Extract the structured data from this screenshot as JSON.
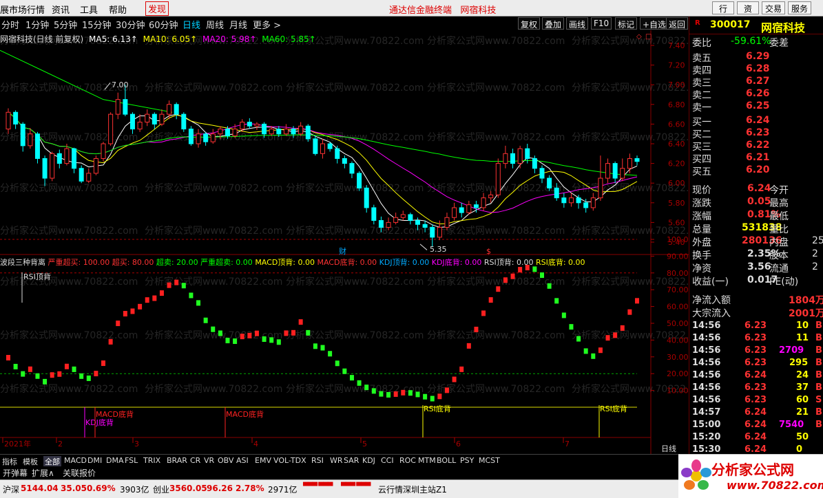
{
  "menu": {
    "left": [
      "展市场行情",
      "资讯",
      "工具",
      "帮助"
    ],
    "discover": "发现",
    "center": "通达信金融终端   网宿科技",
    "right": [
      "行情",
      "资讯",
      "交易",
      "服务"
    ]
  },
  "periods": [
    "分时",
    "1分钟",
    "5分钟",
    "15分钟",
    "30分钟",
    "60分钟",
    "日线",
    "周线",
    "月线",
    "更多 >"
  ],
  "selected_period": "日线",
  "toolbar_right": [
    "复权",
    "叠加",
    "画线",
    "F10",
    "标记",
    "+自选",
    "返回"
  ],
  "main_legend": {
    "name": "网宿科技(日线 前复权)",
    "ma5": "MA5: 6.13↑",
    "ma10": "MA10: 6.05↑",
    "ma20": "MA20: 5.98↑",
    "ma60": "MA60: 5.85↑",
    "colors": {
      "ma5": "#ffffff",
      "ma10": "#ffff00",
      "ma20": "#ff00ff",
      "ma60": "#00ff00",
      "up": "#ff3232",
      "down": "#00ffff"
    }
  },
  "indicator_legend": [
    {
      "text": "波段三种背离",
      "color": "#dddddd"
    },
    {
      "text": "严重超买: 100.00",
      "color": "#ff3232"
    },
    {
      "text": "超买: 80.00",
      "color": "#ff3232"
    },
    {
      "text": "超卖: 20.00",
      "color": "#00ff00"
    },
    {
      "text": "严重超卖: 0.00",
      "color": "#00ff00"
    },
    {
      "text": "MACD顶背: 0.00",
      "color": "#ffff00"
    },
    {
      "text": "MACD底背: 0.00",
      "color": "#ff3232"
    },
    {
      "text": "KDJ顶背: 0.00",
      "color": "#00aaff"
    },
    {
      "text": "KDJ底背: 0.00",
      "color": "#ff00ff"
    },
    {
      "text": "RSI顶背: 0.00",
      "color": "#dddddd"
    },
    {
      "text": "RSI底背: 0.00",
      "color": "#ffff00"
    }
  ],
  "price_axis": [
    "7.40",
    "7.20",
    "7.00",
    "6.80",
    "6.60",
    "6.40",
    "6.20",
    "6.00",
    "5.80",
    "5.60",
    "5.40"
  ],
  "ind_axis": [
    "100.00",
    "90.00",
    "80.00",
    "70.00",
    "60.00",
    "50.00",
    "40.00",
    "30.00",
    "20.00",
    "10.00"
  ],
  "annotations": {
    "high": "7.00",
    "low": "5.35",
    "cai": "财",
    "dollar": "$",
    "rsi_top": "RSI顶背",
    "macd_bottom1": "MACD底背",
    "kdj_bottom": "KDJ底背",
    "macd_bottom2": "MACD底背",
    "rsi_bottom1": "RSI底背",
    "rsi_bottom2": "RSI底背",
    "watermark": "分析家公式网www.70822.com"
  },
  "date_axis": [
    "2021年",
    "2",
    "3",
    "4",
    "5",
    "6",
    "7"
  ],
  "date_axis_right": "日线",
  "stock": {
    "code": "300017",
    "name": "网宿科技"
  },
  "order_book": {
    "weibi": {
      "label": "委比",
      "value": "-59.61%",
      "label2": "委差"
    },
    "sells": [
      {
        "label": "卖五",
        "price": "6.29"
      },
      {
        "label": "卖四",
        "price": "6.28"
      },
      {
        "label": "卖三",
        "price": "6.27"
      },
      {
        "label": "卖二",
        "price": "6.26"
      },
      {
        "label": "卖一",
        "price": "6.25"
      }
    ],
    "buys": [
      {
        "label": "买一",
        "price": "6.24"
      },
      {
        "label": "买二",
        "price": "6.23"
      },
      {
        "label": "买三",
        "price": "6.22"
      },
      {
        "label": "买四",
        "price": "6.21"
      },
      {
        "label": "买五",
        "price": "6.20"
      }
    ]
  },
  "quote": [
    {
      "l": "现价",
      "v": "6.24",
      "r": "今开",
      "vc": "#ff3232"
    },
    {
      "l": "涨跌",
      "v": "0.05",
      "r": "最高",
      "vc": "#ff3232"
    },
    {
      "l": "涨幅",
      "v": "0.81%",
      "r": "最低",
      "vc": "#ff3232"
    },
    {
      "l": "总量",
      "v": "531838",
      "r": "量比",
      "vc": "#ffff00"
    },
    {
      "l": "外盘",
      "v": "280136",
      "r": "内盘",
      "vc": "#ff3232",
      "r2": "25"
    },
    {
      "l": "换手",
      "v": "2.35%",
      "r": "股本",
      "vc": "#dddddd",
      "r2": "2"
    },
    {
      "l": "净资",
      "v": "3.56",
      "r": "流通",
      "vc": "#dddddd",
      "r2": "2"
    },
    {
      "l": "收益(一)",
      "v": "0.017",
      "r": "PE(动)",
      "vc": "#dddddd"
    }
  ],
  "flows": [
    {
      "l": "净流入额",
      "v": "1804万"
    },
    {
      "l": "大宗流入",
      "v": "2001万"
    }
  ],
  "ticks": [
    {
      "t": "14:56",
      "p": "6.23",
      "v": "10",
      "s": "B",
      "vc": "#ffff00"
    },
    {
      "t": "14:56",
      "p": "6.23",
      "v": "11",
      "s": "B",
      "vc": "#ffff00"
    },
    {
      "t": "14:56",
      "p": "6.23",
      "v": "2709",
      "s": "B",
      "vc": "#ff00ff"
    },
    {
      "t": "14:56",
      "p": "6.23",
      "v": "295",
      "s": "B",
      "vc": "#ffff00"
    },
    {
      "t": "14:56",
      "p": "6.24",
      "v": "24",
      "s": "B",
      "vc": "#ffff00"
    },
    {
      "t": "14:56",
      "p": "6.23",
      "v": "37",
      "s": "B",
      "vc": "#ffff00"
    },
    {
      "t": "14:56",
      "p": "6.23",
      "v": "60",
      "s": "S",
      "vc": "#ffff00"
    },
    {
      "t": "14:57",
      "p": "6.24",
      "v": "21",
      "s": "B",
      "vc": "#ffff00"
    },
    {
      "t": "15:00",
      "p": "6.24",
      "v": "7540",
      "s": "B",
      "vc": "#ff00ff"
    },
    {
      "t": "15:20",
      "p": "6.24",
      "v": "50",
      "s": "",
      "vc": "#ffff00"
    },
    {
      "t": "15:30",
      "p": "6.24",
      "v": "0",
      "s": "",
      "vc": "#ffff00"
    }
  ],
  "bottom_tabs": [
    "指标",
    "模板",
    "全部",
    "MACD",
    "DMI",
    "DMA",
    "FSL",
    "TRIX",
    "BRAR",
    "CR",
    "VR",
    "OBV",
    "ASI",
    "EMV",
    "VOL-TDX",
    "RSI",
    "WR",
    "SAR",
    "KDJ",
    "CCI",
    "ROC",
    "MTM",
    "BOLL",
    "PSY",
    "MCST"
  ],
  "active_tab": "全部",
  "bar2": [
    "开弹幕",
    "扩展∧",
    "关联报价"
  ],
  "status": {
    "sh_label": "沪深",
    "sh_val": "5144.04",
    "sh_chg": "35.05",
    "sh_pct": "0.69%",
    "sh_amt": "3903亿",
    "cy_label": "创业",
    "cy_val": "3560.05",
    "cy_chg": "96.26",
    "cy_pct": "2.78%",
    "cy_amt": "2971亿",
    "server": "云行情深圳主站Z1"
  },
  "logo": {
    "text1": "分析家公式网",
    "text2": "www.70822.com"
  },
  "kline": [
    [
      6.55,
      6.72,
      6.76,
      6.5
    ],
    [
      6.72,
      6.6,
      6.74,
      6.55
    ],
    [
      6.6,
      6.38,
      6.62,
      6.32
    ],
    [
      6.38,
      6.5,
      6.56,
      6.35
    ],
    [
      6.5,
      6.25,
      6.52,
      6.2
    ],
    [
      6.25,
      6.05,
      6.28,
      5.97
    ],
    [
      6.05,
      6.3,
      6.32,
      6.02
    ],
    [
      6.3,
      6.2,
      6.34,
      6.15
    ],
    [
      6.2,
      6.35,
      6.4,
      6.18
    ],
    [
      6.35,
      6.15,
      6.36,
      6.1
    ],
    [
      6.15,
      6.02,
      6.18,
      6.0
    ],
    [
      6.02,
      6.1,
      6.15,
      6.0
    ],
    [
      6.1,
      6.25,
      6.28,
      6.08
    ],
    [
      6.25,
      6.4,
      6.42,
      6.22
    ],
    [
      6.4,
      6.7,
      6.72,
      6.38
    ],
    [
      6.7,
      6.85,
      6.92,
      6.65
    ],
    [
      6.85,
      6.7,
      7.0,
      6.68
    ],
    [
      6.7,
      6.55,
      6.72,
      6.5
    ],
    [
      6.55,
      6.62,
      6.7,
      6.52
    ],
    [
      6.62,
      6.7,
      6.75,
      6.58
    ],
    [
      6.7,
      6.6,
      6.72,
      6.55
    ],
    [
      6.6,
      6.7,
      6.75,
      6.58
    ],
    [
      6.7,
      6.8,
      6.84,
      6.65
    ],
    [
      6.8,
      6.7,
      6.82,
      6.65
    ],
    [
      6.7,
      6.55,
      6.72,
      6.52
    ],
    [
      6.55,
      6.4,
      6.58,
      6.38
    ],
    [
      6.4,
      6.5,
      6.55,
      6.36
    ],
    [
      6.5,
      6.42,
      6.52,
      6.38
    ],
    [
      6.42,
      6.5,
      6.55,
      6.4
    ],
    [
      6.5,
      6.55,
      6.58,
      6.45
    ],
    [
      6.55,
      6.48,
      6.58,
      6.45
    ],
    [
      6.48,
      6.55,
      6.6,
      6.46
    ],
    [
      6.55,
      6.62,
      6.65,
      6.52
    ],
    [
      6.62,
      6.58,
      6.66,
      6.55
    ],
    [
      6.58,
      6.6,
      6.62,
      6.54
    ],
    [
      6.6,
      6.5,
      6.62,
      6.46
    ],
    [
      6.5,
      6.55,
      6.58,
      6.48
    ],
    [
      6.55,
      6.5,
      6.58,
      6.47
    ],
    [
      6.5,
      6.55,
      6.6,
      6.48
    ],
    [
      6.55,
      6.5,
      6.58,
      6.46
    ],
    [
      6.5,
      6.58,
      6.62,
      6.48
    ],
    [
      6.58,
      6.45,
      6.6,
      6.42
    ],
    [
      6.45,
      6.3,
      6.48,
      6.28
    ],
    [
      6.3,
      6.4,
      6.45,
      6.25
    ],
    [
      6.4,
      6.35,
      6.42,
      6.32
    ],
    [
      6.35,
      6.25,
      6.38,
      6.2
    ],
    [
      6.25,
      6.2,
      6.28,
      6.15
    ],
    [
      6.2,
      6.1,
      6.22,
      6.05
    ],
    [
      6.1,
      5.95,
      6.12,
      5.92
    ],
    [
      5.95,
      5.75,
      5.98,
      5.7
    ],
    [
      5.75,
      5.62,
      5.78,
      5.58
    ],
    [
      5.62,
      5.55,
      5.66,
      5.5
    ],
    [
      5.55,
      5.6,
      5.65,
      5.52
    ],
    [
      5.6,
      5.65,
      5.7,
      5.58
    ],
    [
      5.65,
      5.68,
      5.72,
      5.62
    ],
    [
      5.68,
      5.62,
      5.7,
      5.58
    ],
    [
      5.62,
      5.58,
      5.65,
      5.52
    ],
    [
      5.58,
      5.55,
      5.62,
      5.5
    ],
    [
      5.55,
      5.45,
      5.58,
      5.35
    ],
    [
      5.45,
      5.55,
      5.62,
      5.42
    ],
    [
      5.55,
      5.65,
      5.7,
      5.52
    ],
    [
      5.65,
      5.75,
      5.8,
      5.62
    ],
    [
      5.75,
      5.7,
      5.8,
      5.65
    ],
    [
      5.7,
      5.78,
      5.82,
      5.68
    ],
    [
      5.78,
      5.75,
      5.82,
      5.7
    ],
    [
      5.75,
      5.85,
      5.9,
      5.72
    ],
    [
      5.85,
      5.88,
      5.92,
      5.8
    ],
    [
      5.88,
      6.2,
      6.25,
      5.85
    ],
    [
      6.2,
      6.3,
      6.38,
      6.15
    ],
    [
      6.3,
      6.2,
      6.35,
      6.15
    ],
    [
      6.2,
      6.35,
      6.38,
      6.15
    ],
    [
      6.35,
      6.25,
      6.4,
      6.2
    ],
    [
      6.25,
      6.15,
      6.28,
      6.1
    ],
    [
      6.15,
      6.05,
      6.18,
      6.0
    ],
    [
      6.05,
      5.95,
      6.08,
      5.92
    ],
    [
      5.95,
      5.85,
      6.0,
      5.82
    ],
    [
      5.85,
      5.8,
      5.9,
      5.75
    ],
    [
      5.8,
      5.85,
      5.9,
      5.76
    ],
    [
      5.85,
      5.8,
      5.88,
      5.74
    ],
    [
      5.8,
      5.75,
      5.84,
      5.7
    ],
    [
      5.75,
      5.85,
      5.9,
      5.72
    ],
    [
      5.85,
      6.05,
      6.28,
      5.82
    ],
    [
      6.05,
      6.2,
      6.25,
      6.0
    ],
    [
      6.2,
      6.05,
      6.22,
      6.0
    ],
    [
      6.05,
      6.15,
      6.25,
      6.02
    ],
    [
      6.15,
      6.25,
      6.3,
      6.1
    ],
    [
      6.25,
      6.22,
      6.28,
      6.18
    ]
  ]
}
